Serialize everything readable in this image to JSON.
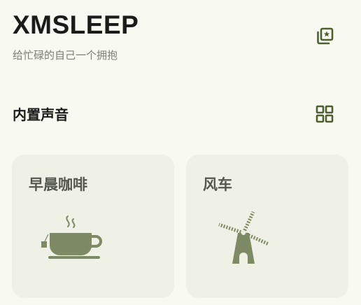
{
  "header": {
    "title": "XMSLEEP",
    "subtitle": "给忙碌的自己一个拥抱",
    "gallery_icon": "photo-library-star-icon"
  },
  "section": {
    "title": "内置声音",
    "view_icon": "grid-view-icon"
  },
  "sounds": [
    {
      "label": "早晨咖啡",
      "icon": "coffee-cup-icon"
    },
    {
      "label": "风车",
      "icon": "windmill-icon"
    }
  ],
  "colors": {
    "background": "#f8f9f0",
    "card": "#eff0e6",
    "accent": "#4e6032",
    "illustration": "#7d8a63",
    "text_primary": "#1b1b19",
    "text_secondary": "#7b7d75"
  }
}
